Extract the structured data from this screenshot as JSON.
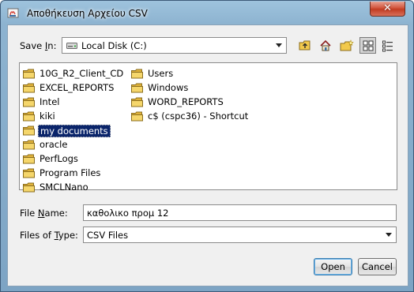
{
  "window": {
    "title": "Αποθήκευση Αρχείου CSV",
    "close_glyph": "✕"
  },
  "save_in": {
    "label_prefix": "Save ",
    "label_mnemonic": "I",
    "label_suffix": "n:",
    "value": "Local Disk (C:)",
    "icon": "drive-icon"
  },
  "toolbar": {
    "buttons": [
      {
        "name": "up-one-level",
        "icon": "folder-up-icon"
      },
      {
        "name": "home",
        "icon": "home-icon"
      },
      {
        "name": "new-folder",
        "icon": "new-folder-icon"
      },
      {
        "name": "list-view",
        "icon": "list-view-icon",
        "pressed": true
      },
      {
        "name": "details-view",
        "icon": "details-view-icon",
        "pressed": false
      }
    ]
  },
  "files": {
    "column1": [
      "10G_R2_Client_CD",
      "EXCEL_REPORTS",
      "Intel",
      "kiki",
      "my documents",
      "oracle",
      "PerfLogs",
      "Program Files",
      "SMCLNano"
    ],
    "column2": [
      "Users",
      "Windows",
      "WORD_REPORTS",
      "c$ (cspc36) - Shortcut"
    ],
    "selected": "my documents"
  },
  "file_name": {
    "label_prefix": "File ",
    "label_mnemonic": "N",
    "label_suffix": "ame:",
    "value": "καθολικο προμ 12"
  },
  "file_type": {
    "label_prefix": "Files of ",
    "label_mnemonic": "T",
    "label_suffix": "ype:",
    "value": "CSV Files"
  },
  "buttons": {
    "open": "Open",
    "cancel": "Cancel"
  },
  "colors": {
    "title_bar": "#8db3d0",
    "selection": "#0a246a",
    "folder": "#f2c94c",
    "close_button": "#c23c22"
  }
}
